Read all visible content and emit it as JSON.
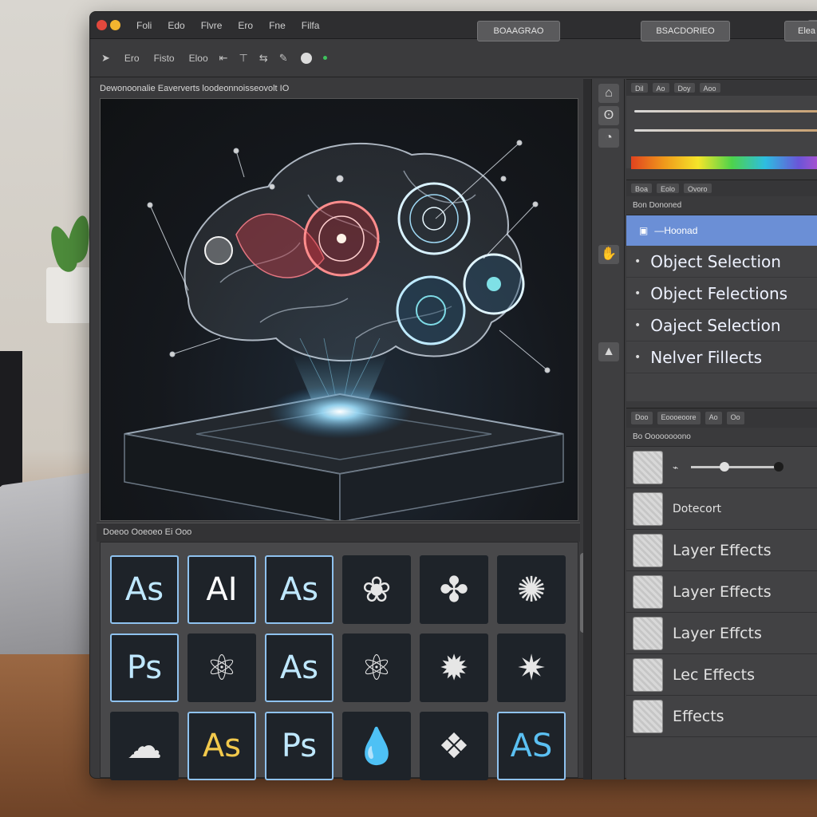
{
  "menubar": {
    "items": [
      "Foli",
      "Edo",
      "Flvre",
      "Ero",
      "Fne",
      "Filfa"
    ]
  },
  "options": {
    "items": [
      "Ero",
      "Fisto",
      "Eloo"
    ],
    "button_left": "BOAAGRAO",
    "button_right": "BSACDORIEO",
    "button_far": "Elea"
  },
  "document": {
    "title": "Dewonoonalie Eaververts loodeonnoisseovolt IO"
  },
  "color_panel": {
    "tabs": [
      "Dil",
      "Ao",
      "Doy",
      "Aoo"
    ]
  },
  "selection_panel": {
    "tabs": [
      "Boa",
      "Eolo",
      "Ovoro"
    ],
    "header": "Bon Dononed",
    "selected_item": "—Hoonad",
    "items": [
      "Object Selection",
      "Object Felections",
      "Oaject Selection",
      "Nelver Fillects"
    ]
  },
  "layers_panel": {
    "tabs": [
      "Doo",
      "Eoooeoore",
      "Ao",
      "Oo"
    ],
    "header": "Bo Oooooooono",
    "layers": [
      "Dotecort",
      "Layer Effects",
      "Layer Effects",
      "Layer Effcts",
      "Lec Effects",
      "Effects"
    ]
  },
  "assets_panel": {
    "label": "Doeoo Ooeoeo Ei Ooo",
    "tiles": [
      {
        "label": "As",
        "color": "#bfe8ff"
      },
      {
        "label": "AI",
        "color": "#ffffff"
      },
      {
        "label": "As",
        "color": "#bfe8ff"
      },
      {
        "label": "",
        "icon": "lotus-icon"
      },
      {
        "label": "",
        "icon": "flower-icon"
      },
      {
        "label": "",
        "icon": "mandala-icon"
      },
      {
        "label": "Ps",
        "color": "#bfe8ff"
      },
      {
        "label": "",
        "icon": "atom-icon"
      },
      {
        "label": "As",
        "color": "#bfe8ff"
      },
      {
        "label": "",
        "icon": "atom-icon"
      },
      {
        "label": "",
        "icon": "burst-icon"
      },
      {
        "label": "",
        "icon": "crystal-icon"
      },
      {
        "label": "",
        "icon": "cloud-icon"
      },
      {
        "label": "As",
        "color": "#f2c94c"
      },
      {
        "label": "Ps",
        "color": "#bfe8ff"
      },
      {
        "label": "",
        "icon": "drop-icon"
      },
      {
        "label": "",
        "icon": "glyph-icon"
      },
      {
        "label": "AS",
        "color": "#5bc0f2"
      }
    ]
  },
  "colors": {
    "accent_blue": "#6b8fd6",
    "tile_border": "#8fc2ef",
    "window_bg": "#3a3a3c"
  }
}
